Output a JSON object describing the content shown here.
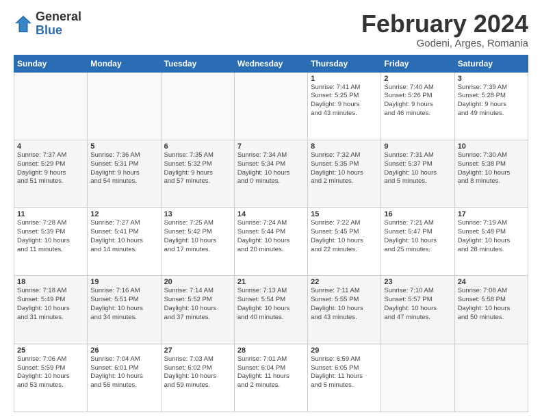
{
  "logo": {
    "general": "General",
    "blue": "Blue"
  },
  "title": "February 2024",
  "subtitle": "Godeni, Arges, Romania",
  "days_header": [
    "Sunday",
    "Monday",
    "Tuesday",
    "Wednesday",
    "Thursday",
    "Friday",
    "Saturday"
  ],
  "weeks": [
    [
      {
        "day": "",
        "info": ""
      },
      {
        "day": "",
        "info": ""
      },
      {
        "day": "",
        "info": ""
      },
      {
        "day": "",
        "info": ""
      },
      {
        "day": "1",
        "info": "Sunrise: 7:41 AM\nSunset: 5:25 PM\nDaylight: 9 hours\nand 43 minutes."
      },
      {
        "day": "2",
        "info": "Sunrise: 7:40 AM\nSunset: 5:26 PM\nDaylight: 9 hours\nand 46 minutes."
      },
      {
        "day": "3",
        "info": "Sunrise: 7:39 AM\nSunset: 5:28 PM\nDaylight: 9 hours\nand 49 minutes."
      }
    ],
    [
      {
        "day": "4",
        "info": "Sunrise: 7:37 AM\nSunset: 5:29 PM\nDaylight: 9 hours\nand 51 minutes."
      },
      {
        "day": "5",
        "info": "Sunrise: 7:36 AM\nSunset: 5:31 PM\nDaylight: 9 hours\nand 54 minutes."
      },
      {
        "day": "6",
        "info": "Sunrise: 7:35 AM\nSunset: 5:32 PM\nDaylight: 9 hours\nand 57 minutes."
      },
      {
        "day": "7",
        "info": "Sunrise: 7:34 AM\nSunset: 5:34 PM\nDaylight: 10 hours\nand 0 minutes."
      },
      {
        "day": "8",
        "info": "Sunrise: 7:32 AM\nSunset: 5:35 PM\nDaylight: 10 hours\nand 2 minutes."
      },
      {
        "day": "9",
        "info": "Sunrise: 7:31 AM\nSunset: 5:37 PM\nDaylight: 10 hours\nand 5 minutes."
      },
      {
        "day": "10",
        "info": "Sunrise: 7:30 AM\nSunset: 5:38 PM\nDaylight: 10 hours\nand 8 minutes."
      }
    ],
    [
      {
        "day": "11",
        "info": "Sunrise: 7:28 AM\nSunset: 5:39 PM\nDaylight: 10 hours\nand 11 minutes."
      },
      {
        "day": "12",
        "info": "Sunrise: 7:27 AM\nSunset: 5:41 PM\nDaylight: 10 hours\nand 14 minutes."
      },
      {
        "day": "13",
        "info": "Sunrise: 7:25 AM\nSunset: 5:42 PM\nDaylight: 10 hours\nand 17 minutes."
      },
      {
        "day": "14",
        "info": "Sunrise: 7:24 AM\nSunset: 5:44 PM\nDaylight: 10 hours\nand 20 minutes."
      },
      {
        "day": "15",
        "info": "Sunrise: 7:22 AM\nSunset: 5:45 PM\nDaylight: 10 hours\nand 22 minutes."
      },
      {
        "day": "16",
        "info": "Sunrise: 7:21 AM\nSunset: 5:47 PM\nDaylight: 10 hours\nand 25 minutes."
      },
      {
        "day": "17",
        "info": "Sunrise: 7:19 AM\nSunset: 5:48 PM\nDaylight: 10 hours\nand 28 minutes."
      }
    ],
    [
      {
        "day": "18",
        "info": "Sunrise: 7:18 AM\nSunset: 5:49 PM\nDaylight: 10 hours\nand 31 minutes."
      },
      {
        "day": "19",
        "info": "Sunrise: 7:16 AM\nSunset: 5:51 PM\nDaylight: 10 hours\nand 34 minutes."
      },
      {
        "day": "20",
        "info": "Sunrise: 7:14 AM\nSunset: 5:52 PM\nDaylight: 10 hours\nand 37 minutes."
      },
      {
        "day": "21",
        "info": "Sunrise: 7:13 AM\nSunset: 5:54 PM\nDaylight: 10 hours\nand 40 minutes."
      },
      {
        "day": "22",
        "info": "Sunrise: 7:11 AM\nSunset: 5:55 PM\nDaylight: 10 hours\nand 43 minutes."
      },
      {
        "day": "23",
        "info": "Sunrise: 7:10 AM\nSunset: 5:57 PM\nDaylight: 10 hours\nand 47 minutes."
      },
      {
        "day": "24",
        "info": "Sunrise: 7:08 AM\nSunset: 5:58 PM\nDaylight: 10 hours\nand 50 minutes."
      }
    ],
    [
      {
        "day": "25",
        "info": "Sunrise: 7:06 AM\nSunset: 5:59 PM\nDaylight: 10 hours\nand 53 minutes."
      },
      {
        "day": "26",
        "info": "Sunrise: 7:04 AM\nSunset: 6:01 PM\nDaylight: 10 hours\nand 56 minutes."
      },
      {
        "day": "27",
        "info": "Sunrise: 7:03 AM\nSunset: 6:02 PM\nDaylight: 10 hours\nand 59 minutes."
      },
      {
        "day": "28",
        "info": "Sunrise: 7:01 AM\nSunset: 6:04 PM\nDaylight: 11 hours\nand 2 minutes."
      },
      {
        "day": "29",
        "info": "Sunrise: 6:59 AM\nSunset: 6:05 PM\nDaylight: 11 hours\nand 5 minutes."
      },
      {
        "day": "",
        "info": ""
      },
      {
        "day": "",
        "info": ""
      }
    ]
  ]
}
